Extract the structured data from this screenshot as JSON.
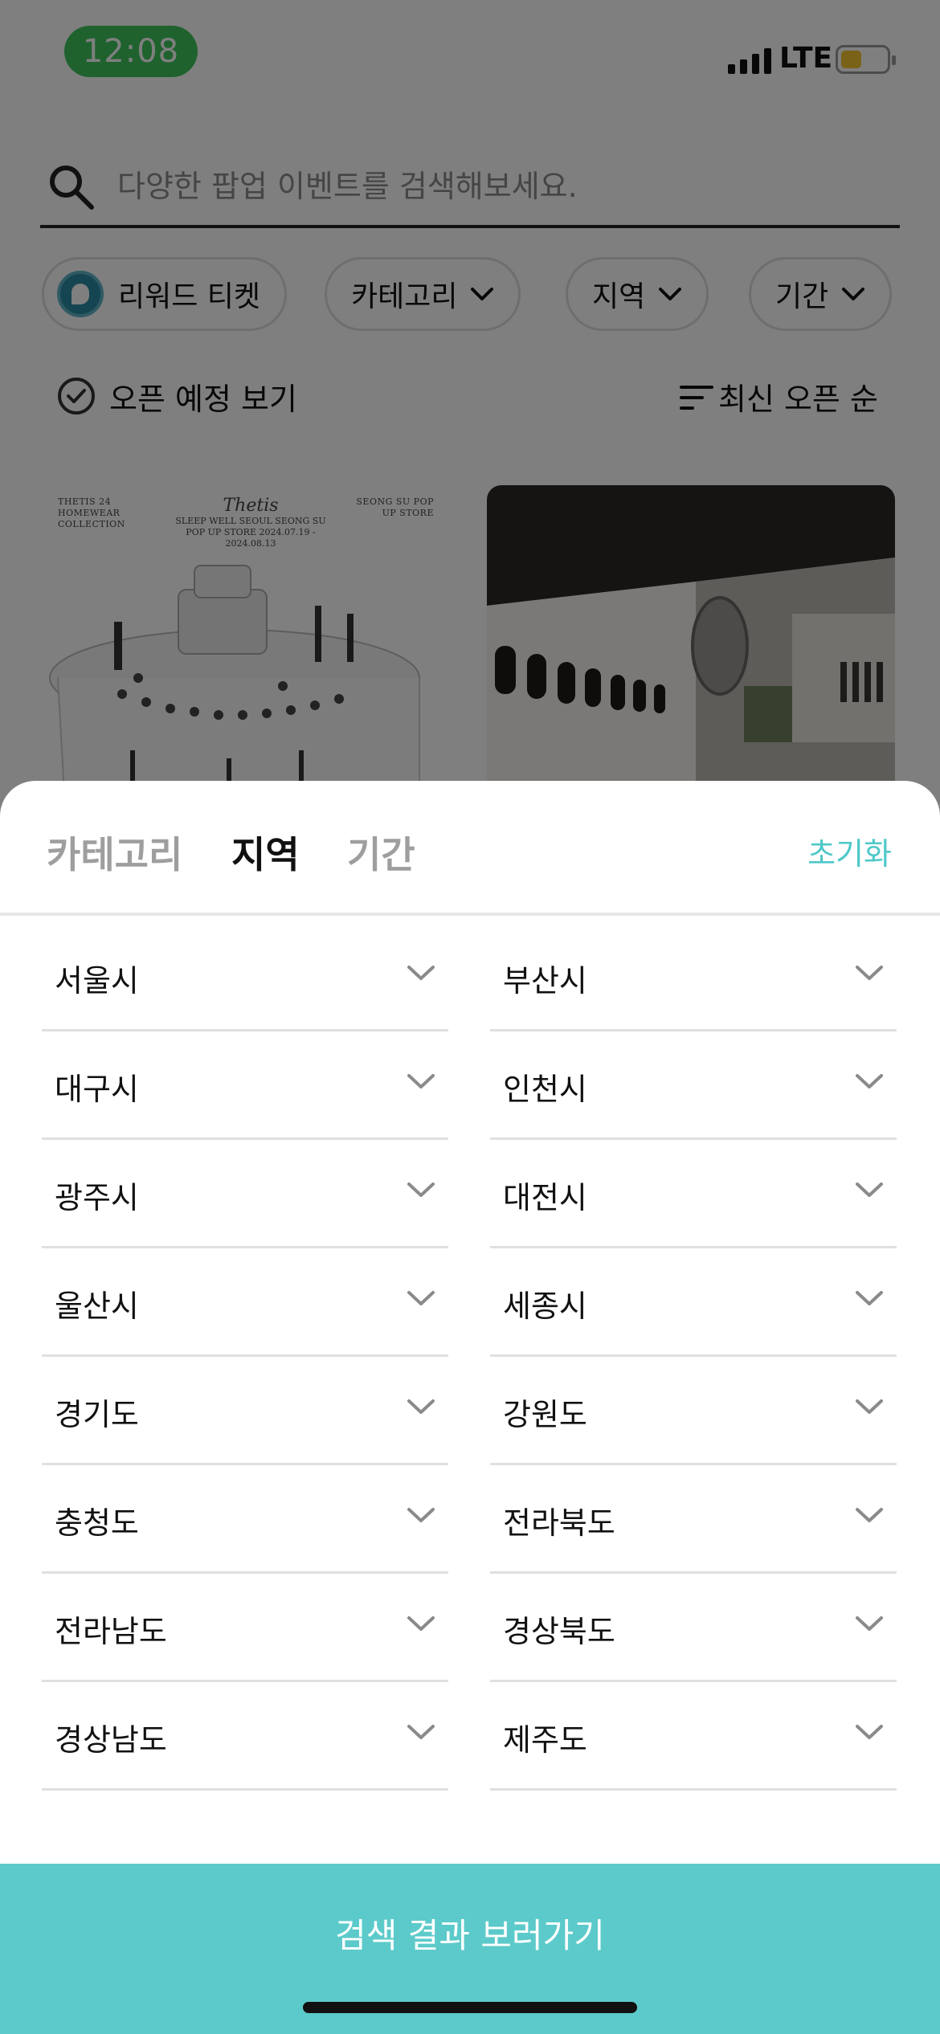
{
  "status_bar": {
    "time": "12:08",
    "network": "LTE",
    "signal_bars": 4,
    "battery_level": 0.45,
    "time_pill_color": "#3ec45c",
    "battery_color": "#f4c430"
  },
  "search": {
    "placeholder": "다양한 팝업 이벤트를 검색해보세요.",
    "icon": "search-icon"
  },
  "chips": [
    {
      "label": "리워드 티켓",
      "icon": "reward-ticket-logo"
    },
    {
      "label": "카테고리",
      "icon": "chevron-down-icon"
    },
    {
      "label": "지역",
      "icon": "chevron-down-icon"
    },
    {
      "label": "기간",
      "icon": "chevron-down-icon"
    }
  ],
  "filter_row": {
    "open_label": "오픈 예정 보기",
    "sort_label": "최신 오픈 순"
  },
  "cards": [
    {
      "left_header": "THETIS 24 HOMEWEAR COLLECTION",
      "center_script": "Thetis",
      "center_text": "SLEEP WELL SEOUL SEONG SU POP UP STORE 2024.07.19 - 2024.08.13",
      "right_header": "SEONG SU POP UP STORE"
    },
    {}
  ],
  "sheet": {
    "tabs": [
      {
        "label": "카테고리",
        "active": false
      },
      {
        "label": "지역",
        "active": true
      },
      {
        "label": "기간",
        "active": false
      }
    ],
    "reset_label": "초기화",
    "accent_color": "#4fc8c8",
    "regions": [
      "서울시",
      "부산시",
      "대구시",
      "인천시",
      "광주시",
      "대전시",
      "울산시",
      "세종시",
      "경기도",
      "강원도",
      "충청도",
      "전라북도",
      "전라남도",
      "경상북도",
      "경상남도",
      "제주도"
    ],
    "cta_label": "검색 결과 보러가기",
    "cta_color": "#5ccaca"
  }
}
